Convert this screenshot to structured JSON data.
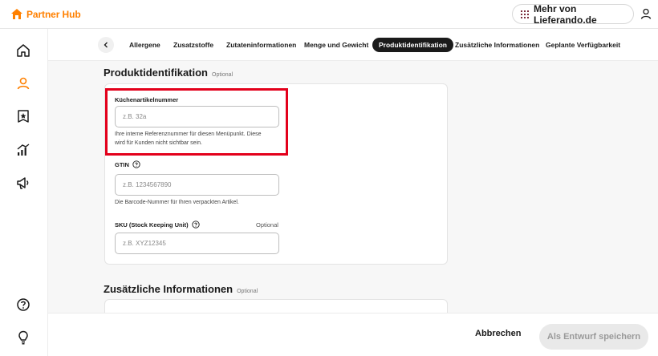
{
  "header": {
    "brand": "Partner Hub",
    "more_button": "Mehr von Lieferando.de"
  },
  "tabs": [
    {
      "label": "Allergene",
      "active": false
    },
    {
      "label": "Zusatzstoffe",
      "active": false
    },
    {
      "label": "Zutateninformationen",
      "active": false
    },
    {
      "label": "Menge und Gewicht",
      "active": false
    },
    {
      "label": "Produktidentifikation",
      "active": true
    },
    {
      "label": "Zusätzliche Informationen",
      "active": false
    },
    {
      "label": "Geplante Verfügbarkeit",
      "active": false
    }
  ],
  "section1": {
    "title": "Produktidentifikation",
    "optional": "Optional",
    "fields": {
      "kitchen": {
        "label": "Küchenartikelnummer",
        "placeholder": "z.B. 32a",
        "hint_line1": "Ihre interne Referenznummer für diesen Menüpunkt. Diese",
        "hint_line2": "wird für Kunden nicht sichtbar sein."
      },
      "gtin": {
        "label": "GTIN",
        "placeholder": "z.B. 1234567890",
        "hint": "Die Barcode-Nummer für Ihren verpackten Artikel."
      },
      "sku": {
        "label": "SKU (Stock Keeping Unit)",
        "optional": "Optional",
        "placeholder": "z.B. XYZ12345"
      }
    }
  },
  "section2": {
    "title": "Zusätzliche Informationen",
    "optional": "Optional"
  },
  "footer": {
    "cancel": "Abbrechen",
    "save_draft": "Als Entwurf speichern"
  },
  "colors": {
    "brand": "#ff8000",
    "highlight": "#e3001b",
    "active_tab": "#1a1a1a"
  },
  "icons": [
    "home-icon",
    "user-icon",
    "menu-icon",
    "chart-icon",
    "megaphone-icon",
    "help-icon",
    "lightbulb-icon",
    "grid-icon",
    "chevron-left-icon"
  ]
}
